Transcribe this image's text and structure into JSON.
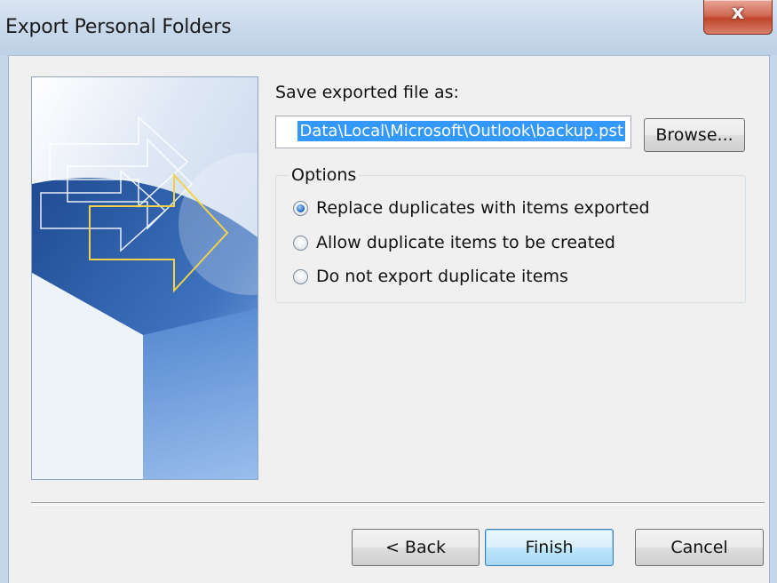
{
  "window": {
    "title": "Export Personal Folders",
    "close_label": "x"
  },
  "form": {
    "save_label": "Save exported file as:",
    "file_path": "Data\\Local\\Microsoft\\Outlook\\backup.pst",
    "browse_label": "Browse..."
  },
  "options": {
    "legend": "Options",
    "items": [
      {
        "label": "Replace duplicates with items exported",
        "checked": true
      },
      {
        "label": "Allow duplicate items to be created",
        "checked": false
      },
      {
        "label": "Do not export duplicate items",
        "checked": false
      }
    ]
  },
  "buttons": {
    "back": "< Back",
    "finish": "Finish",
    "cancel": "Cancel"
  },
  "colors": {
    "banner_blue": "#2f5fa6",
    "selection": "#3399ff",
    "close_red": "#c0462c"
  }
}
